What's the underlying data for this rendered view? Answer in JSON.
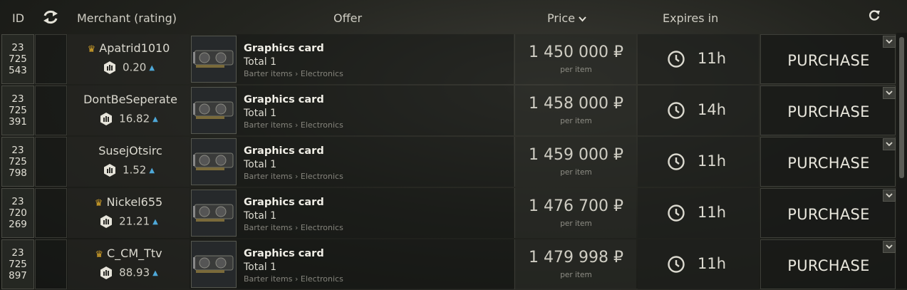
{
  "header": {
    "id": "ID",
    "merchant": "Merchant (rating)",
    "offer": "Offer",
    "price": "Price",
    "expires": "Expires in"
  },
  "icons": {
    "refresh": "arrows-exchange-icon",
    "reload": "reload-icon",
    "sort": "chevron-down-icon",
    "rating": "hex-rating-icon",
    "crown": "crown-icon",
    "clock": "clock-icon",
    "trend": "arrow-up-icon"
  },
  "colors": {
    "crown": "#d9a62a",
    "trend_up": "#4ea8d8"
  },
  "rows": [
    {
      "id": [
        "23",
        "725",
        "543"
      ],
      "crown": "♛",
      "merchant": "Apatrid1010",
      "rating": "0.20",
      "offer_title": "Graphics card",
      "offer_total": "Total 1",
      "offer_category": "Barter items › Electronics",
      "price": "1 450 000 ₽",
      "per_item": "per item",
      "expires": "11h",
      "action": "PURCHASE"
    },
    {
      "id": [
        "23",
        "725",
        "391"
      ],
      "crown": "",
      "merchant": "DontBeSeperate",
      "rating": "16.82",
      "offer_title": "Graphics card",
      "offer_total": "Total 1",
      "offer_category": "Barter items › Electronics",
      "price": "1 458 000 ₽",
      "per_item": "per item",
      "expires": "14h",
      "action": "PURCHASE"
    },
    {
      "id": [
        "23",
        "725",
        "798"
      ],
      "crown": "",
      "merchant": "SusejOtsirc",
      "rating": "1.52",
      "offer_title": "Graphics card",
      "offer_total": "Total 1",
      "offer_category": "Barter items › Electronics",
      "price": "1 459 000 ₽",
      "per_item": "per item",
      "expires": "11h",
      "action": "PURCHASE"
    },
    {
      "id": [
        "23",
        "720",
        "269"
      ],
      "crown": "♛",
      "merchant": "Nickel655",
      "rating": "21.21",
      "offer_title": "Graphics card",
      "offer_total": "Total 1",
      "offer_category": "Barter items › Electronics",
      "price": "1 476 700 ₽",
      "per_item": "per item",
      "expires": "11h",
      "action": "PURCHASE"
    },
    {
      "id": [
        "23",
        "725",
        "897"
      ],
      "crown": "♛",
      "merchant": "C_CM_Ttv",
      "rating": "88.93",
      "offer_title": "Graphics card",
      "offer_total": "Total 1",
      "offer_category": "Barter items › Electronics",
      "price": "1 479 998 ₽",
      "per_item": "per item",
      "expires": "11h",
      "action": "PURCHASE"
    }
  ]
}
